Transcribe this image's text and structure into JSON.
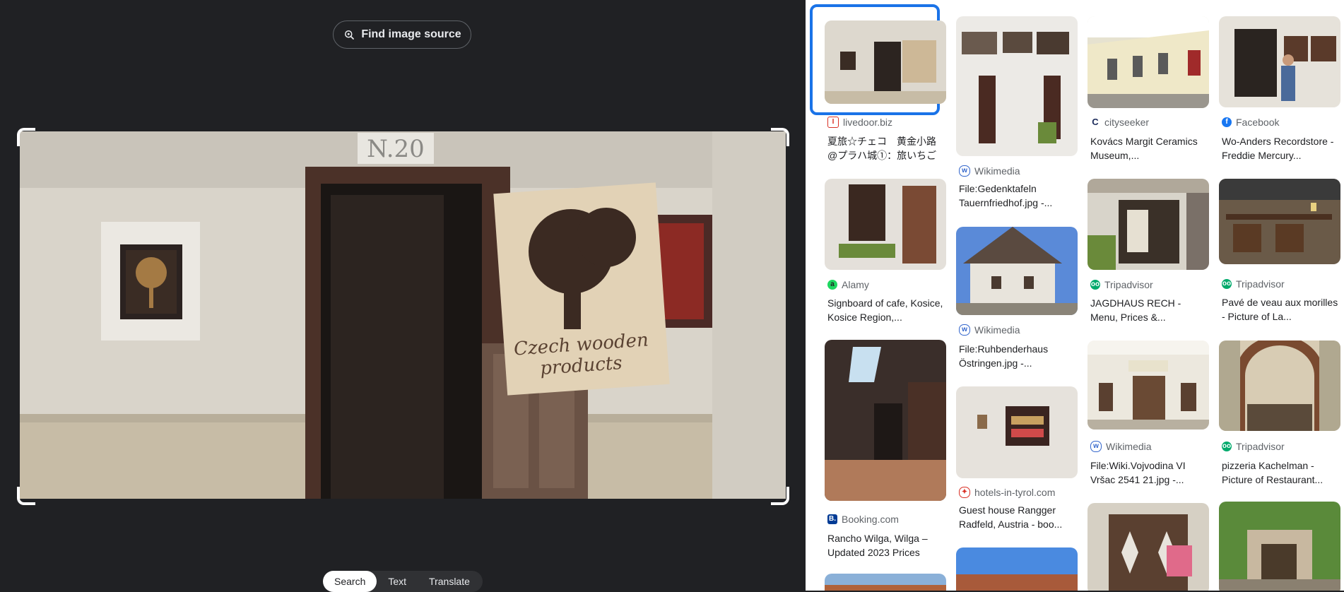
{
  "toolbar": {
    "find_source_label": "Find image source"
  },
  "bottom_tabs": [
    {
      "label": "Search",
      "active": true
    },
    {
      "label": "Text",
      "active": false
    },
    {
      "label": "Translate",
      "active": false
    }
  ],
  "photo": {
    "house_number": "N.20",
    "sign_line1": "Czech wooden",
    "sign_line2": "products"
  },
  "results": {
    "col1": [
      {
        "source": "livedoor.biz",
        "title": "夏旅☆チェコ　黄金小路 @プラハ城①：旅いちご"
      },
      {
        "source": "Alamy",
        "title": "Signboard of cafe, Kosice, Kosice Region,..."
      },
      {
        "source": "Booking.com",
        "title": "Rancho Wilga, Wilga – Updated 2023 Prices"
      }
    ],
    "col2": [
      {
        "source": "Wikimedia",
        "title": "File:Gedenktafeln Tauernfriedhof.jpg -..."
      },
      {
        "source": "Wikimedia",
        "title": "File:Ruhbenderhaus Östringen.jpg -..."
      },
      {
        "source": "hotels-in-tyrol.com",
        "title": "Guest house Rangger Radfeld, Austria - boo..."
      }
    ],
    "col3": [
      {
        "source": "cityseeker",
        "title": "Kovács Margit Ceramics Museum,..."
      },
      {
        "source": "Tripadvisor",
        "title": "JAGDHAUS RECH - Menu, Prices &..."
      },
      {
        "source": "Wikimedia",
        "title": "File:Wiki.Vojvodina VI Vršac 2541 21.jpg -..."
      }
    ],
    "col4": [
      {
        "source": "Facebook",
        "title": "Wo-Anders Recordstore - Freddie Mercury..."
      },
      {
        "source": "Tripadvisor",
        "title": "Pavé de veau aux morilles - Picture of La..."
      },
      {
        "source": "Tripadvisor",
        "title": "pizzeria Kachelman - Picture of Restaurant..."
      }
    ]
  },
  "colors": {
    "selection": "#1a73e8",
    "dark_bg": "#202124"
  }
}
